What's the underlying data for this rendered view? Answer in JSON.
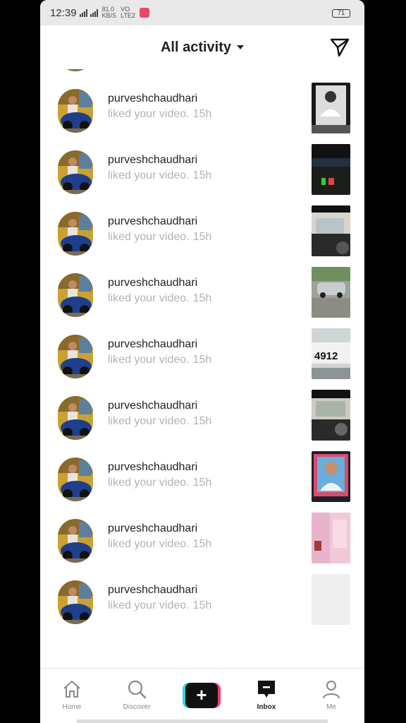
{
  "status_bar": {
    "time": "12:39",
    "speed": "81.0",
    "speed_unit": "KB/S",
    "volte": "VO",
    "lte": "LTE2",
    "battery": "71"
  },
  "header": {
    "title": "All activity"
  },
  "activities": [
    {
      "username": "purveshchaudhari",
      "action": "liked your video.",
      "time": "15h",
      "thumb": "t0"
    },
    {
      "username": "purveshchaudhari",
      "action": "liked your video.",
      "time": "15h",
      "thumb": "t1"
    },
    {
      "username": "purveshchaudhari",
      "action": "liked your video.",
      "time": "15h",
      "thumb": "t2"
    },
    {
      "username": "purveshchaudhari",
      "action": "liked your video.",
      "time": "15h",
      "thumb": "t3"
    },
    {
      "username": "purveshchaudhari",
      "action": "liked your video.",
      "time": "15h",
      "thumb": "t4"
    },
    {
      "username": "purveshchaudhari",
      "action": "liked your video.",
      "time": "15h",
      "thumb": "t5"
    },
    {
      "username": "purveshchaudhari",
      "action": "liked your video.",
      "time": "15h",
      "thumb": "t6"
    },
    {
      "username": "purveshchaudhari",
      "action": "liked your video.",
      "time": "15h",
      "thumb": "t7"
    },
    {
      "username": "purveshchaudhari",
      "action": "liked your video.",
      "time": "15h",
      "thumb": "t8"
    },
    {
      "username": "purveshchaudhari",
      "action": "liked your video.",
      "time": "15h",
      "thumb": "t9"
    }
  ],
  "thumb_text": {
    "plate": "4912"
  },
  "nav": {
    "home": "Home",
    "discover": "Discover",
    "inbox": "Inbox",
    "me": "Me"
  },
  "colors": {
    "accent_cyan": "#2fd6e0",
    "accent_pink": "#f43a67",
    "secondary_text": "#b3b3b3"
  }
}
